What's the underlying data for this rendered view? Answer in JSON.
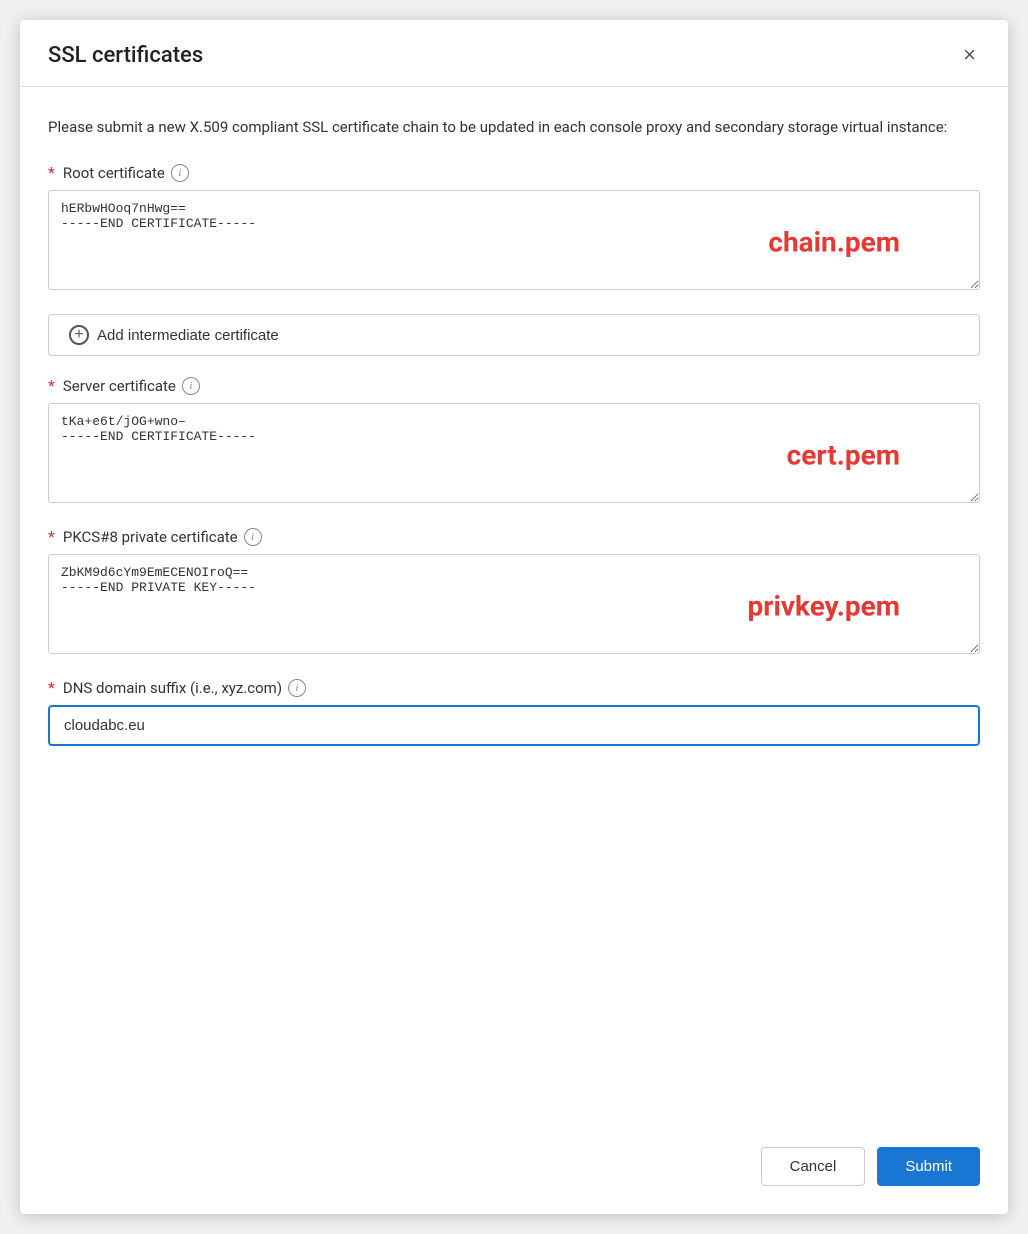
{
  "dialog": {
    "title": "SSL certificates",
    "description": "Please submit a new X.509 compliant SSL certificate chain to be updated in each console proxy and secondary storage virtual instance:",
    "close_label": "×"
  },
  "fields": {
    "root_certificate": {
      "label": "Root certificate",
      "required": true,
      "textarea_content": "hERbwHOoq7nHwg==\n-----END CERTIFICATE-----",
      "overlay": "chain.pem"
    },
    "add_intermediate": {
      "label": "Add intermediate certificate"
    },
    "server_certificate": {
      "label": "Server certificate",
      "required": true,
      "textarea_content": "tKa+e6t/jOG+wno–\n-----END CERTIFICATE-----",
      "overlay": "cert.pem"
    },
    "pkcs8_certificate": {
      "label": "PKCS#8 private certificate",
      "required": true,
      "textarea_content": "ZbKM9d6cYm9EmECENOIroQ==\n-----END PRIVATE KEY-----",
      "overlay": "privkey.pem"
    },
    "dns_domain": {
      "label": "DNS domain suffix (i.e., xyz.com)",
      "required": true,
      "value": "cloudabc.eu",
      "placeholder": ""
    }
  },
  "footer": {
    "cancel_label": "Cancel",
    "submit_label": "Submit"
  },
  "icons": {
    "info": "i",
    "plus": "+",
    "close": "×"
  }
}
